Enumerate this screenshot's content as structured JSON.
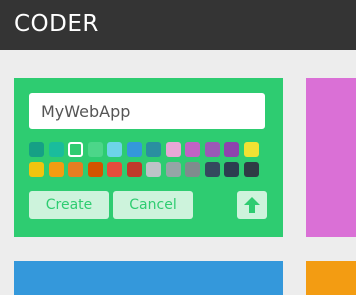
{
  "header": {
    "title": "CODER"
  },
  "form": {
    "name_value": "MyWebApp",
    "create_label": "Create",
    "cancel_label": "Cancel",
    "upload_icon": "upload-arrow-icon"
  },
  "palette": {
    "selected_index": 2,
    "colors": [
      "#16a085",
      "#1abc9c",
      "#2ecc71",
      "#4cd689",
      "#6dd4e8",
      "#3498db",
      "#2a8fa0",
      "#e8a7d6",
      "#c163c4",
      "#9b59b6",
      "#8e44ad",
      "#f1e233",
      "#f1c40f",
      "#f39c12",
      "#e67e22",
      "#d35400",
      "#e74c3c",
      "#c0392b",
      "#bdc3c7",
      "#95a5a6",
      "#7f8c8d",
      "#34495e",
      "#2c3e50",
      "#2f3b45"
    ]
  },
  "tiles": {
    "form_color": "#2ecc71",
    "pink": "#da70d6",
    "blue": "#3498db",
    "orange": "#f39c12"
  }
}
